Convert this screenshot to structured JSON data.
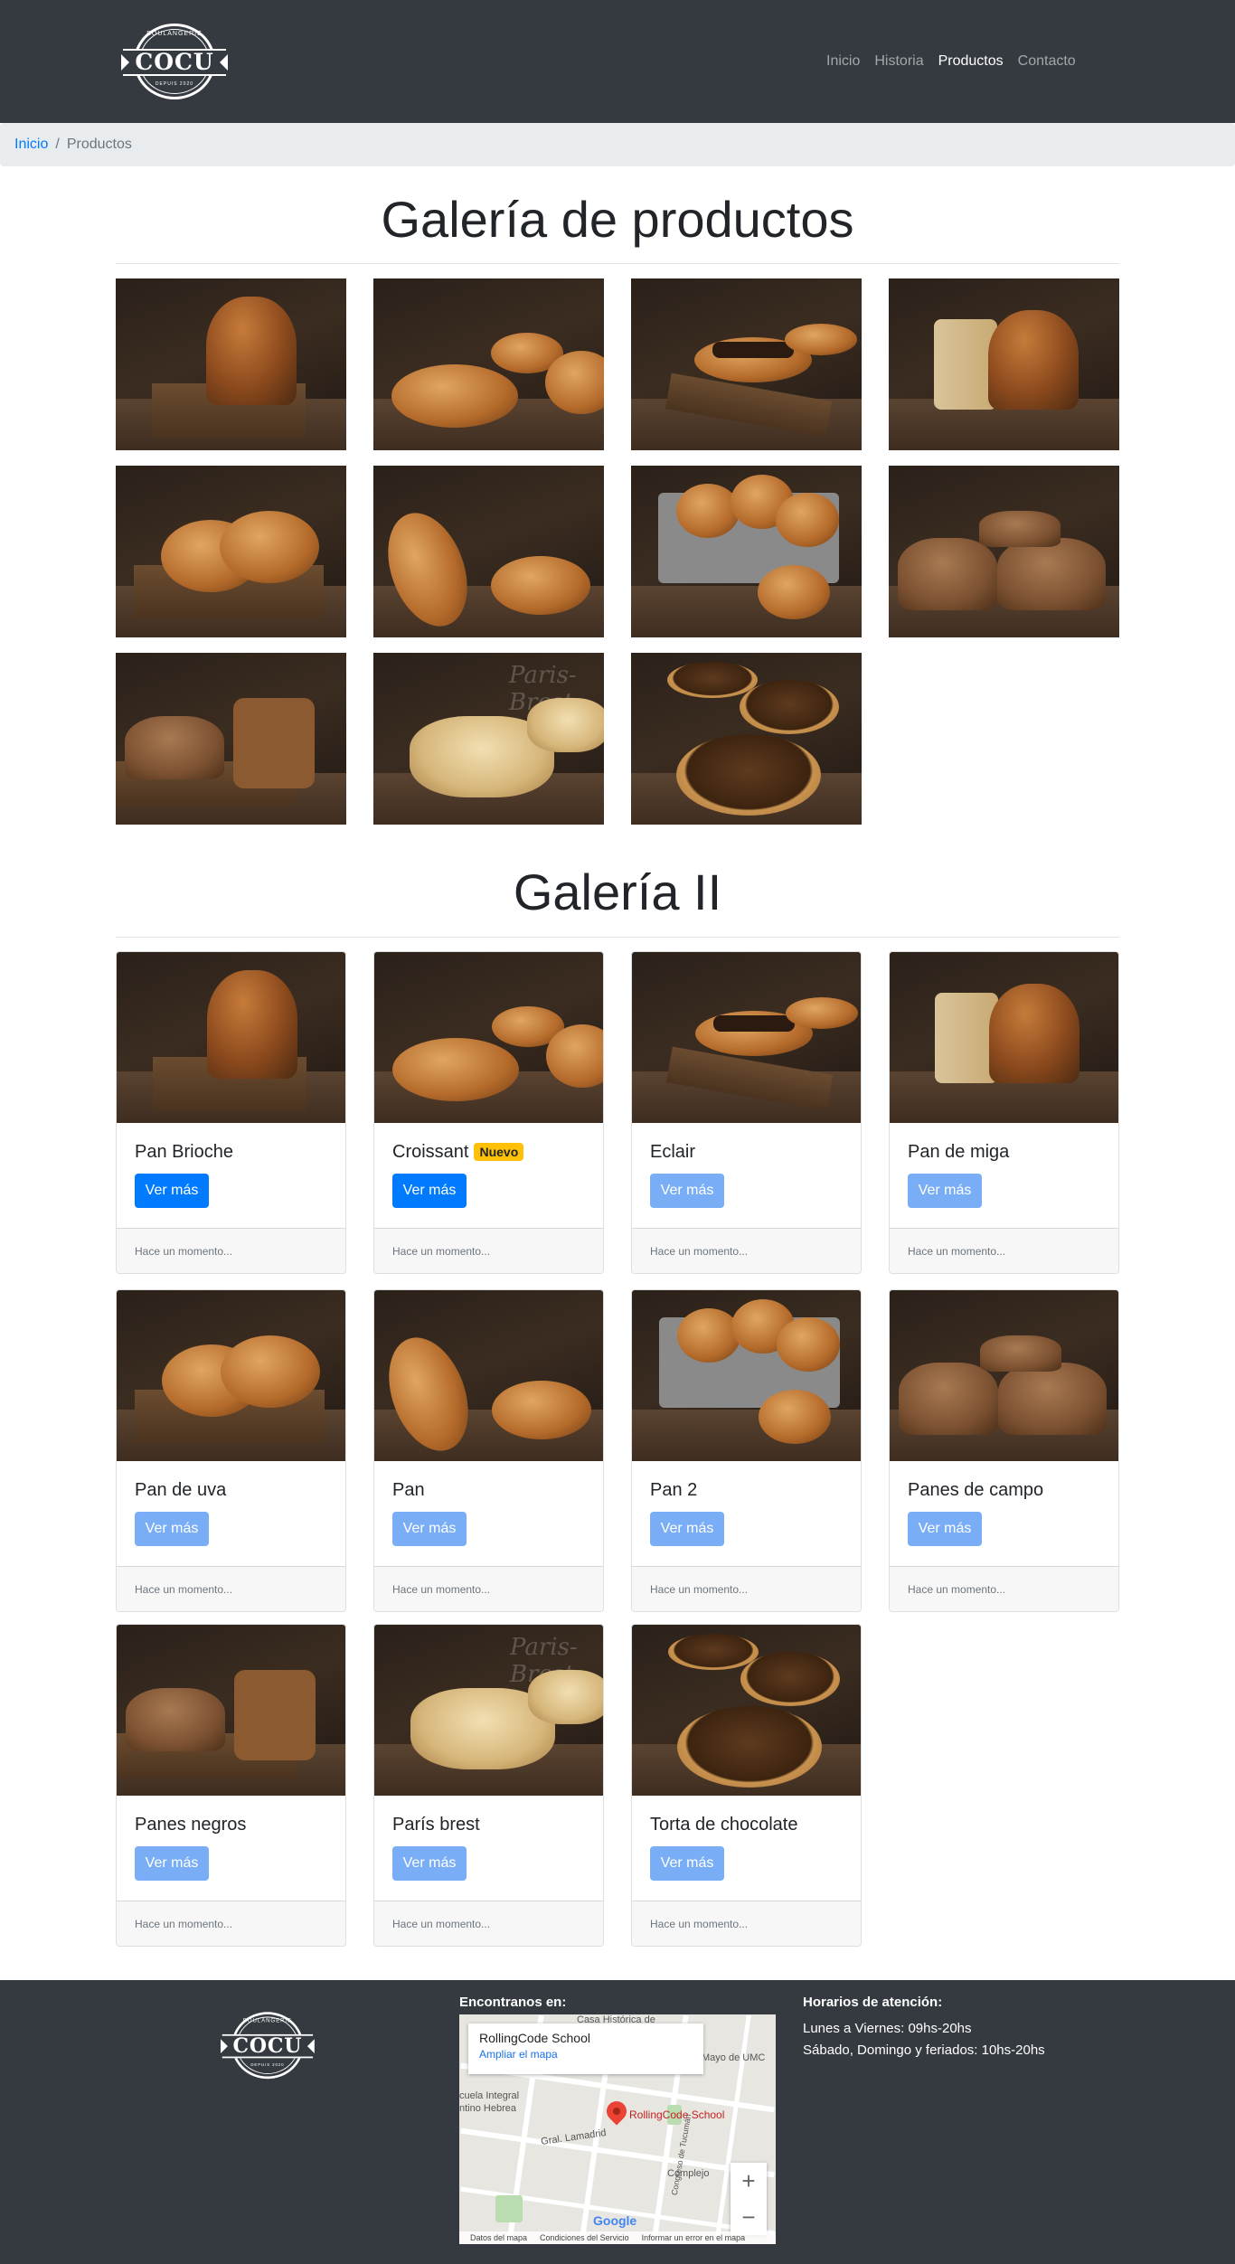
{
  "navbar": {
    "logo": {
      "word": "COCU",
      "arc_top": "BOULANGERIE",
      "arc_bottom": "DEPUIS 2020"
    },
    "links": [
      "Inicio",
      "Historia",
      "Productos",
      "Contacto"
    ],
    "active": "Productos"
  },
  "breadcrumb": {
    "home": "Inicio",
    "separator": "/",
    "current": "Productos"
  },
  "gallery1": {
    "title": "Galería de productos",
    "images": [
      "pan-brioche",
      "croissant",
      "eclair",
      "pan-de-miga",
      "pan-de-uva",
      "pan",
      "pan-2",
      "panes-de-campo",
      "panes-negros",
      "paris-brest",
      "torta-de-chocolate"
    ]
  },
  "gallery2": {
    "title": "Galería II",
    "cards": [
      {
        "title": "Pan Brioche",
        "badge": "",
        "button": "Ver más",
        "footer": "Hace un momento..."
      },
      {
        "title": "Croissant",
        "badge": "Nuevo",
        "button": "Ver más",
        "footer": "Hace un momento..."
      },
      {
        "title": "Eclair",
        "badge": "",
        "button": "Ver más",
        "footer": "Hace un momento..."
      },
      {
        "title": "Pan de miga",
        "badge": "",
        "button": "Ver más",
        "footer": "Hace un momento..."
      },
      {
        "title": "Pan de uva",
        "badge": "",
        "button": "Ver más",
        "footer": "Hace un momento..."
      },
      {
        "title": "Pan",
        "badge": "",
        "button": "Ver más",
        "footer": "Hace un momento..."
      },
      {
        "title": "Pan 2",
        "badge": "",
        "button": "Ver más",
        "footer": "Hace un momento..."
      },
      {
        "title": "Panes de campo",
        "badge": "",
        "button": "Ver más",
        "footer": "Hace un momento..."
      },
      {
        "title": "Panes negros",
        "badge": "",
        "button": "Ver más",
        "footer": "Hace un momento..."
      },
      {
        "title": "París brest",
        "badge": "",
        "button": "Ver más",
        "footer": "Hace un momento..."
      },
      {
        "title": "Torta de chocolate",
        "badge": "",
        "button": "Ver más",
        "footer": "Hace un momento..."
      }
    ]
  },
  "footer": {
    "map_heading": "Encontranos en:",
    "hours_heading": "Horarios de atención:",
    "hours": [
      "Lunes a Viernes: 09hs-20hs",
      "Sábado, Domingo y feriados: 10hs-20hs"
    ],
    "map": {
      "place_name": "RollingCode School",
      "enlarge_link": "Ampliar el mapa",
      "pin_label": "RollingCode School",
      "labels": [
        "Casa Histórica de",
        "Mayo de UMC",
        "cuela Integral",
        "ntino Hebrea",
        "Gral. Lamadrid",
        "Complejo",
        "Congreso de Tucumán"
      ],
      "zoom_in": "+",
      "zoom_out": "−",
      "google": "Google",
      "attribution": [
        "Datos del mapa",
        "Condiciones del Servicio",
        "Informar un error en el mapa"
      ]
    }
  },
  "colors": {
    "navbar": "#343a40",
    "primary": "#007bff",
    "badge": "#ffc107",
    "breadcrumb_bg": "#e9ecef"
  }
}
